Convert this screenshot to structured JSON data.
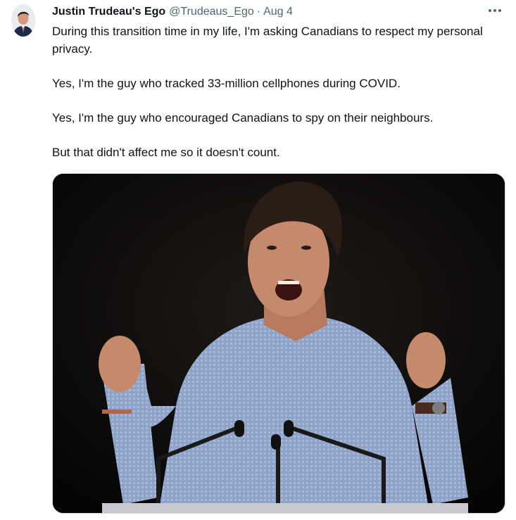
{
  "tweet": {
    "author": {
      "display_name": "Justin Trudeau's Ego",
      "handle": "@Trudeaus_Ego",
      "avatar_icon": "profile-photo"
    },
    "separator": "·",
    "date": "Aug 4",
    "more_icon": "more-horizontal-icon",
    "text_paragraphs": [
      "During this transition time in my life, I'm asking Canadians to respect my personal privacy.",
      "Yes, I'm the guy who tracked 33-million cellphones during COVID.",
      "Yes, I'm the guy who encouraged Canadians to spy on their neighbours.",
      "But that didn't affect me so it doesn't count."
    ],
    "media": {
      "type": "photo",
      "colors": {
        "background": "#0d0b0a",
        "shirt": "#8fa3c9",
        "skin": "#c58a6c",
        "hair": "#2a1d16"
      }
    }
  }
}
